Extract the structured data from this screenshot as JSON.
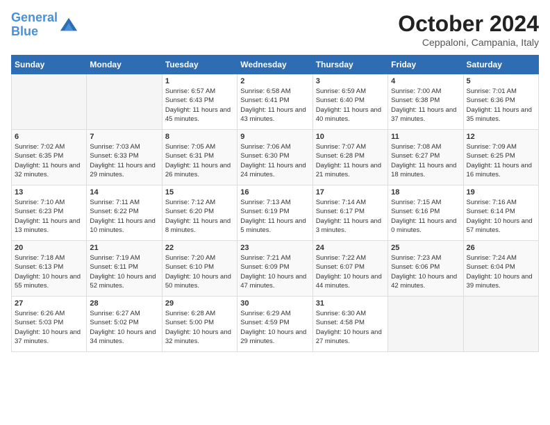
{
  "header": {
    "logo_line1": "General",
    "logo_line2": "Blue",
    "month_title": "October 2024",
    "location": "Ceppaloni, Campania, Italy"
  },
  "days_of_week": [
    "Sunday",
    "Monday",
    "Tuesday",
    "Wednesday",
    "Thursday",
    "Friday",
    "Saturday"
  ],
  "weeks": [
    [
      {
        "day": "",
        "sunrise": "",
        "sunset": "",
        "daylight": ""
      },
      {
        "day": "",
        "sunrise": "",
        "sunset": "",
        "daylight": ""
      },
      {
        "day": "1",
        "sunrise": "Sunrise: 6:57 AM",
        "sunset": "Sunset: 6:43 PM",
        "daylight": "Daylight: 11 hours and 45 minutes."
      },
      {
        "day": "2",
        "sunrise": "Sunrise: 6:58 AM",
        "sunset": "Sunset: 6:41 PM",
        "daylight": "Daylight: 11 hours and 43 minutes."
      },
      {
        "day": "3",
        "sunrise": "Sunrise: 6:59 AM",
        "sunset": "Sunset: 6:40 PM",
        "daylight": "Daylight: 11 hours and 40 minutes."
      },
      {
        "day": "4",
        "sunrise": "Sunrise: 7:00 AM",
        "sunset": "Sunset: 6:38 PM",
        "daylight": "Daylight: 11 hours and 37 minutes."
      },
      {
        "day": "5",
        "sunrise": "Sunrise: 7:01 AM",
        "sunset": "Sunset: 6:36 PM",
        "daylight": "Daylight: 11 hours and 35 minutes."
      }
    ],
    [
      {
        "day": "6",
        "sunrise": "Sunrise: 7:02 AM",
        "sunset": "Sunset: 6:35 PM",
        "daylight": "Daylight: 11 hours and 32 minutes."
      },
      {
        "day": "7",
        "sunrise": "Sunrise: 7:03 AM",
        "sunset": "Sunset: 6:33 PM",
        "daylight": "Daylight: 11 hours and 29 minutes."
      },
      {
        "day": "8",
        "sunrise": "Sunrise: 7:05 AM",
        "sunset": "Sunset: 6:31 PM",
        "daylight": "Daylight: 11 hours and 26 minutes."
      },
      {
        "day": "9",
        "sunrise": "Sunrise: 7:06 AM",
        "sunset": "Sunset: 6:30 PM",
        "daylight": "Daylight: 11 hours and 24 minutes."
      },
      {
        "day": "10",
        "sunrise": "Sunrise: 7:07 AM",
        "sunset": "Sunset: 6:28 PM",
        "daylight": "Daylight: 11 hours and 21 minutes."
      },
      {
        "day": "11",
        "sunrise": "Sunrise: 7:08 AM",
        "sunset": "Sunset: 6:27 PM",
        "daylight": "Daylight: 11 hours and 18 minutes."
      },
      {
        "day": "12",
        "sunrise": "Sunrise: 7:09 AM",
        "sunset": "Sunset: 6:25 PM",
        "daylight": "Daylight: 11 hours and 16 minutes."
      }
    ],
    [
      {
        "day": "13",
        "sunrise": "Sunrise: 7:10 AM",
        "sunset": "Sunset: 6:23 PM",
        "daylight": "Daylight: 11 hours and 13 minutes."
      },
      {
        "day": "14",
        "sunrise": "Sunrise: 7:11 AM",
        "sunset": "Sunset: 6:22 PM",
        "daylight": "Daylight: 11 hours and 10 minutes."
      },
      {
        "day": "15",
        "sunrise": "Sunrise: 7:12 AM",
        "sunset": "Sunset: 6:20 PM",
        "daylight": "Daylight: 11 hours and 8 minutes."
      },
      {
        "day": "16",
        "sunrise": "Sunrise: 7:13 AM",
        "sunset": "Sunset: 6:19 PM",
        "daylight": "Daylight: 11 hours and 5 minutes."
      },
      {
        "day": "17",
        "sunrise": "Sunrise: 7:14 AM",
        "sunset": "Sunset: 6:17 PM",
        "daylight": "Daylight: 11 hours and 3 minutes."
      },
      {
        "day": "18",
        "sunrise": "Sunrise: 7:15 AM",
        "sunset": "Sunset: 6:16 PM",
        "daylight": "Daylight: 11 hours and 0 minutes."
      },
      {
        "day": "19",
        "sunrise": "Sunrise: 7:16 AM",
        "sunset": "Sunset: 6:14 PM",
        "daylight": "Daylight: 10 hours and 57 minutes."
      }
    ],
    [
      {
        "day": "20",
        "sunrise": "Sunrise: 7:18 AM",
        "sunset": "Sunset: 6:13 PM",
        "daylight": "Daylight: 10 hours and 55 minutes."
      },
      {
        "day": "21",
        "sunrise": "Sunrise: 7:19 AM",
        "sunset": "Sunset: 6:11 PM",
        "daylight": "Daylight: 10 hours and 52 minutes."
      },
      {
        "day": "22",
        "sunrise": "Sunrise: 7:20 AM",
        "sunset": "Sunset: 6:10 PM",
        "daylight": "Daylight: 10 hours and 50 minutes."
      },
      {
        "day": "23",
        "sunrise": "Sunrise: 7:21 AM",
        "sunset": "Sunset: 6:09 PM",
        "daylight": "Daylight: 10 hours and 47 minutes."
      },
      {
        "day": "24",
        "sunrise": "Sunrise: 7:22 AM",
        "sunset": "Sunset: 6:07 PM",
        "daylight": "Daylight: 10 hours and 44 minutes."
      },
      {
        "day": "25",
        "sunrise": "Sunrise: 7:23 AM",
        "sunset": "Sunset: 6:06 PM",
        "daylight": "Daylight: 10 hours and 42 minutes."
      },
      {
        "day": "26",
        "sunrise": "Sunrise: 7:24 AM",
        "sunset": "Sunset: 6:04 PM",
        "daylight": "Daylight: 10 hours and 39 minutes."
      }
    ],
    [
      {
        "day": "27",
        "sunrise": "Sunrise: 6:26 AM",
        "sunset": "Sunset: 5:03 PM",
        "daylight": "Daylight: 10 hours and 37 minutes."
      },
      {
        "day": "28",
        "sunrise": "Sunrise: 6:27 AM",
        "sunset": "Sunset: 5:02 PM",
        "daylight": "Daylight: 10 hours and 34 minutes."
      },
      {
        "day": "29",
        "sunrise": "Sunrise: 6:28 AM",
        "sunset": "Sunset: 5:00 PM",
        "daylight": "Daylight: 10 hours and 32 minutes."
      },
      {
        "day": "30",
        "sunrise": "Sunrise: 6:29 AM",
        "sunset": "Sunset: 4:59 PM",
        "daylight": "Daylight: 10 hours and 29 minutes."
      },
      {
        "day": "31",
        "sunrise": "Sunrise: 6:30 AM",
        "sunset": "Sunset: 4:58 PM",
        "daylight": "Daylight: 10 hours and 27 minutes."
      },
      {
        "day": "",
        "sunrise": "",
        "sunset": "",
        "daylight": ""
      },
      {
        "day": "",
        "sunrise": "",
        "sunset": "",
        "daylight": ""
      }
    ]
  ]
}
